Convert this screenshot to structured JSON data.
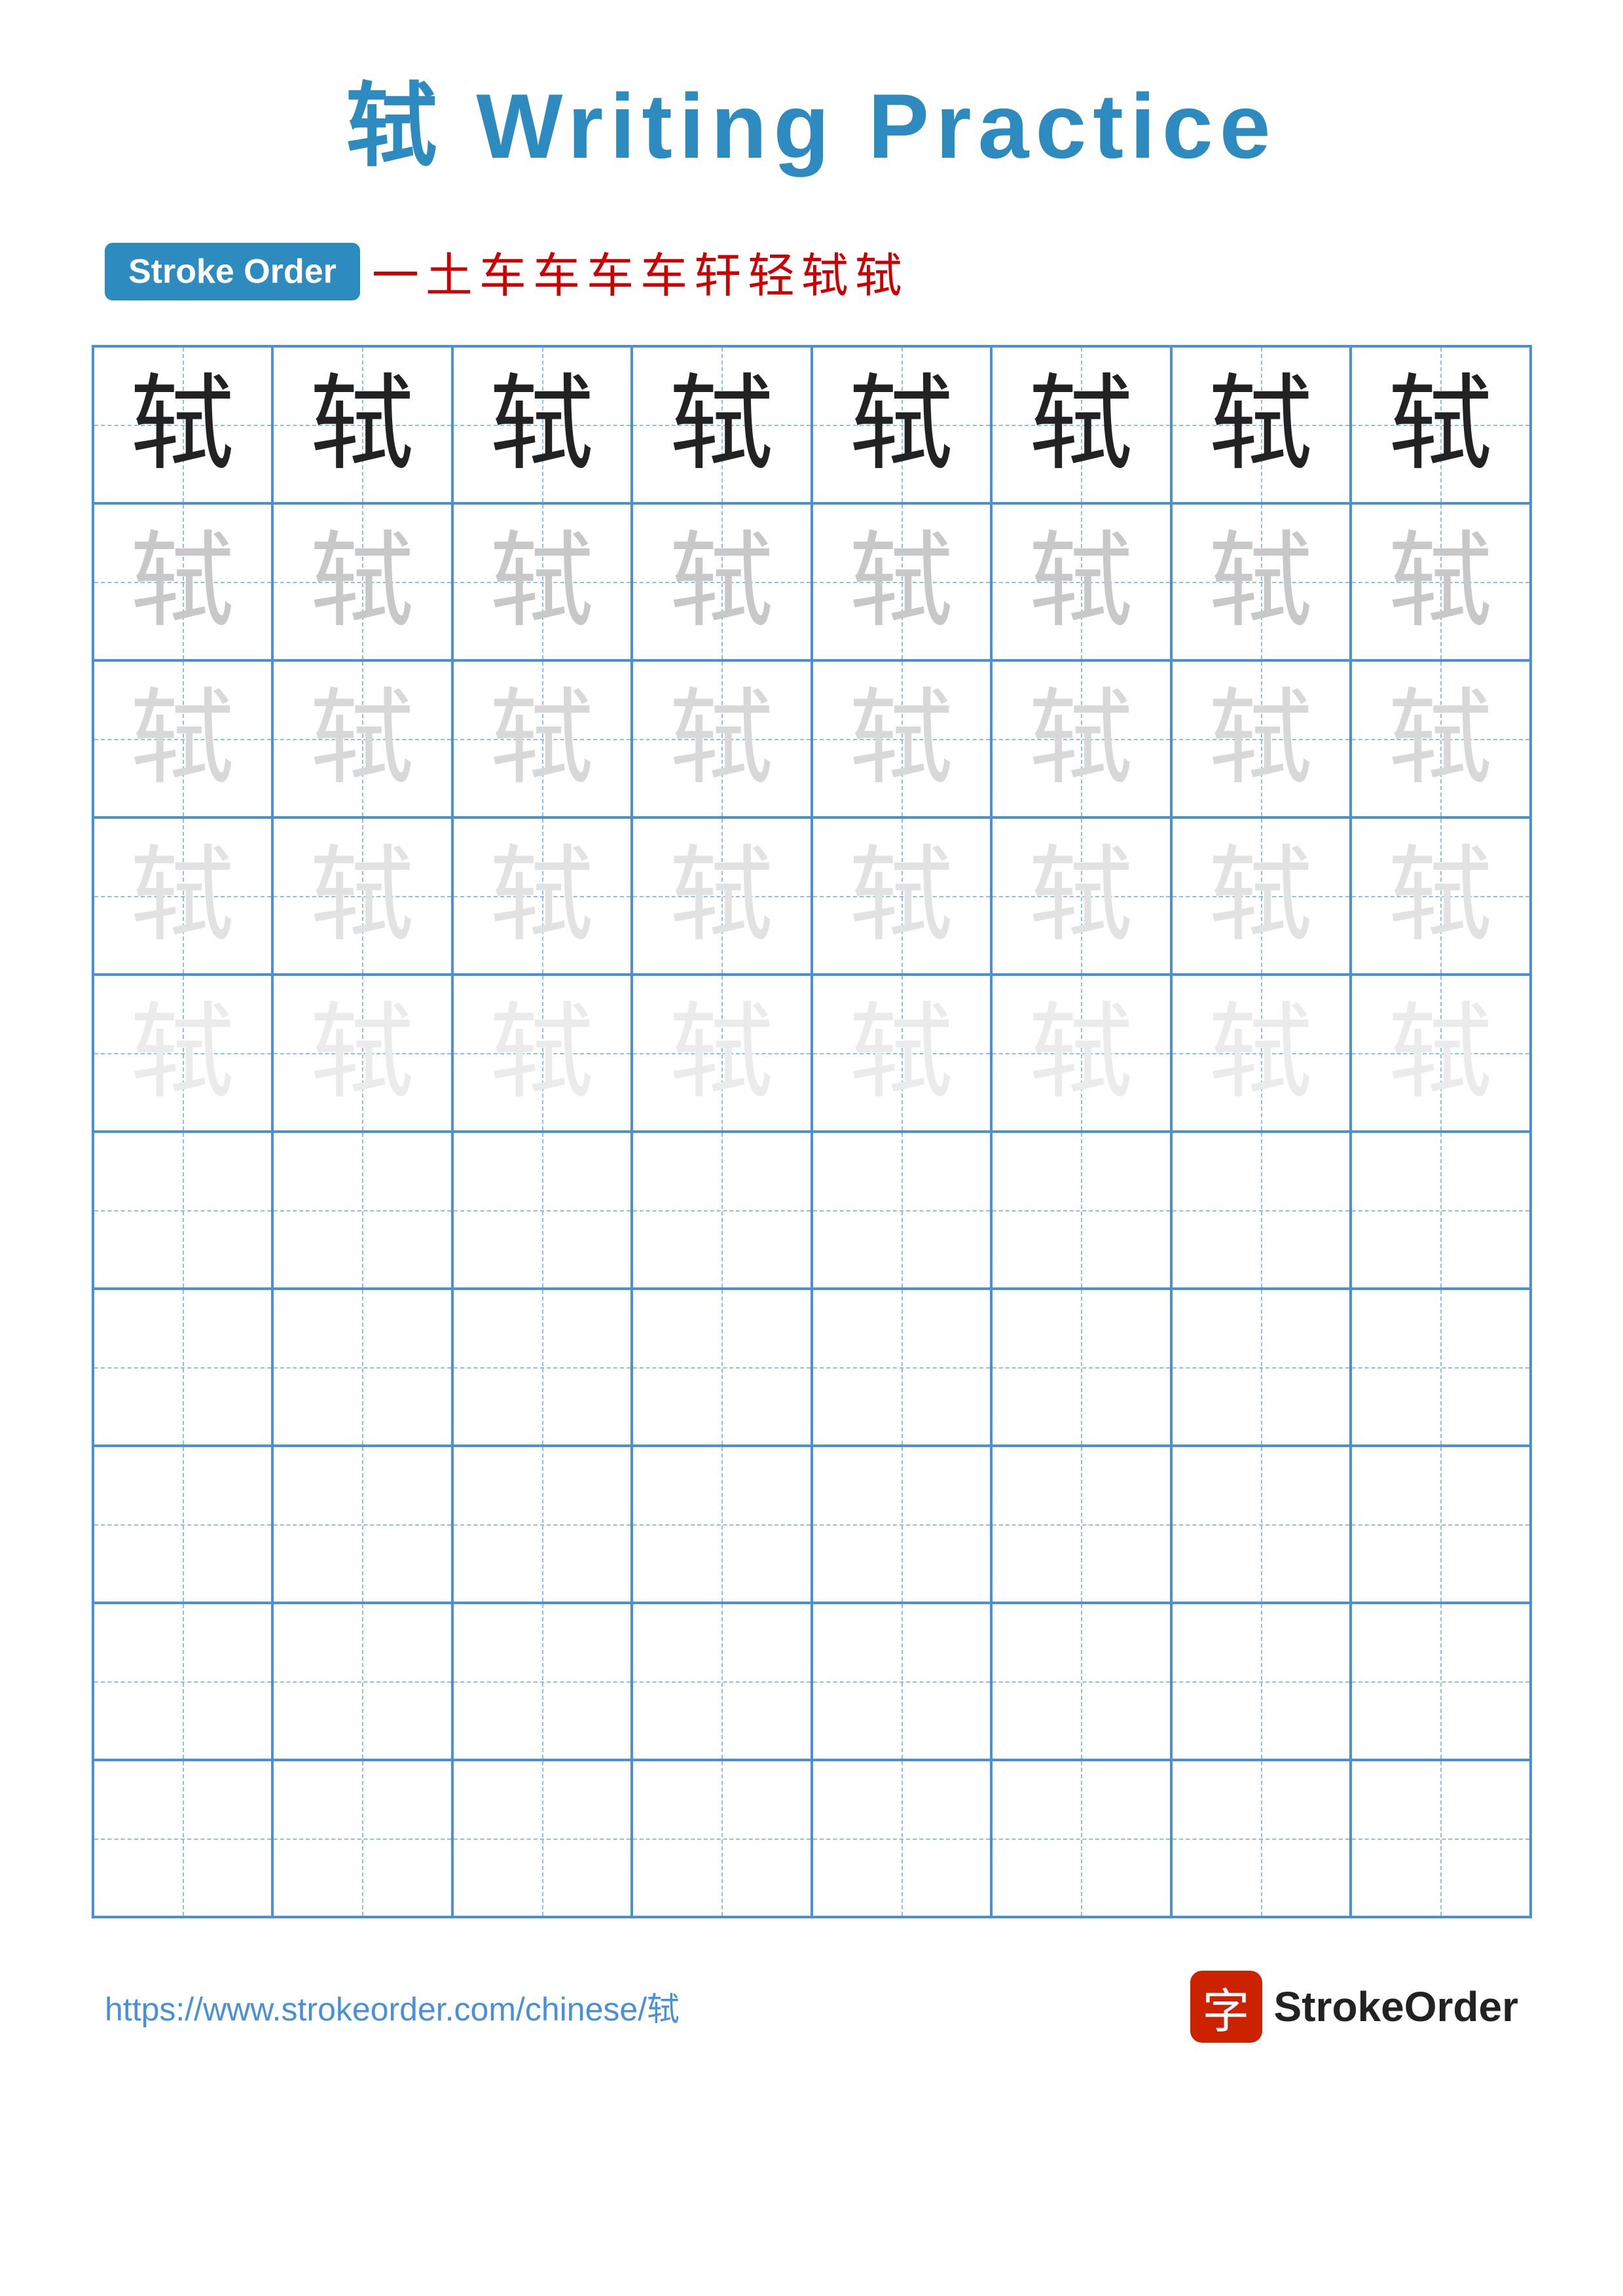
{
  "title": {
    "char": "轼",
    "label": "Writing Practice",
    "full": "轼 Writing Practice"
  },
  "stroke_order": {
    "badge_label": "Stroke Order",
    "strokes": [
      "一",
      "土",
      "车",
      "车",
      "车",
      "车",
      "轩",
      "轻",
      "轼",
      "轼"
    ]
  },
  "grid": {
    "rows": 10,
    "cols": 8,
    "char": "轼",
    "filled_rows": 5,
    "shade_levels": [
      "dark",
      "light1",
      "light2",
      "light3",
      "light4"
    ]
  },
  "footer": {
    "url": "https://www.strokeorder.com/chinese/轼",
    "logo_char": "字",
    "logo_name": "StrokeOrder"
  }
}
